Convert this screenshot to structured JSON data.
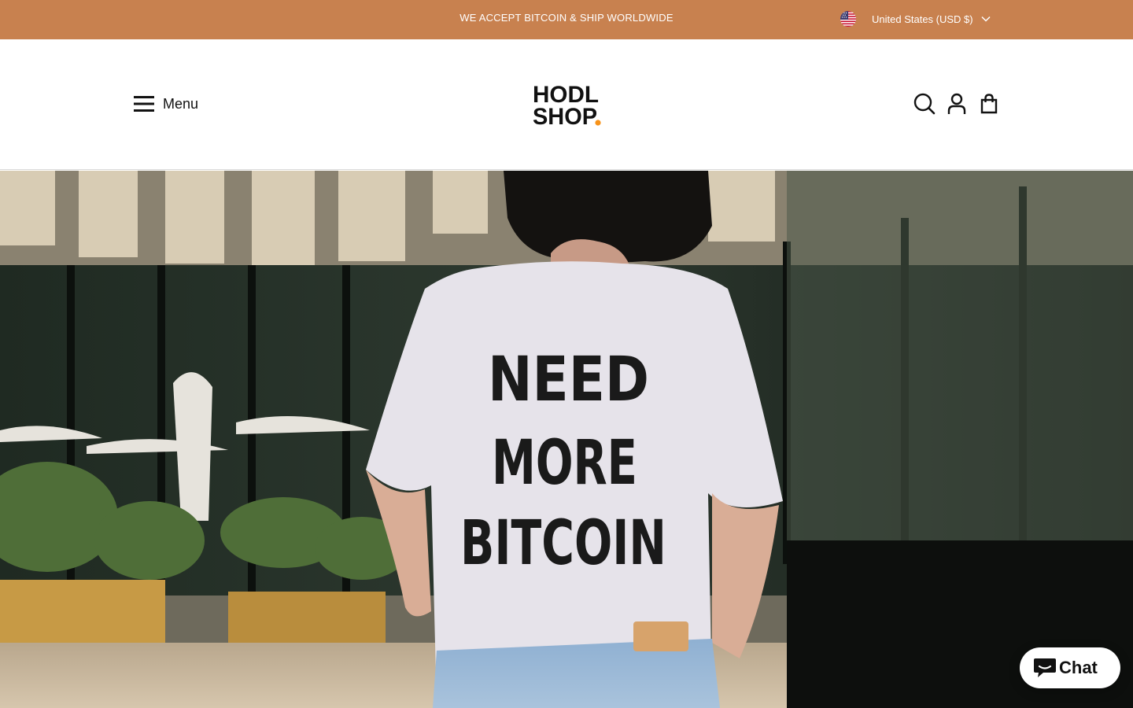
{
  "announcement": {
    "text": "WE ACCEPT BITCOIN & SHIP WORLDWIDE"
  },
  "country_selector": {
    "label": "United States (USD $)",
    "flag": "us-flag-icon"
  },
  "header": {
    "menu_label": "Menu",
    "logo_text": "HODL SHOP"
  },
  "header_icons": [
    "search-icon",
    "account-icon",
    "cart-icon"
  ],
  "hero": {
    "shirt_text": [
      "NEED",
      "MORE",
      "BITCOIN"
    ]
  },
  "chat": {
    "label": "Chat"
  },
  "colors": {
    "announcement_bg": "#c8814f",
    "logo_accent": "#f7931a"
  }
}
